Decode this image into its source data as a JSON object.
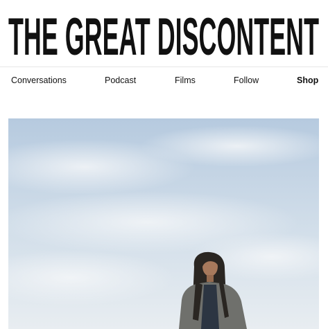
{
  "site": {
    "title": "THE GREAT DISCONTENT"
  },
  "nav": {
    "items": [
      {
        "label": "Conversations"
      },
      {
        "label": "Podcast"
      },
      {
        "label": "Films"
      },
      {
        "label": "Follow"
      },
      {
        "label": "Shop"
      }
    ]
  },
  "colors": {
    "text": "#111111",
    "divider": "#e6e6e6",
    "sky_top": "#b9cde0",
    "sky_bottom": "#e9eef2"
  },
  "hero": {
    "subject": "portrait-photo"
  }
}
